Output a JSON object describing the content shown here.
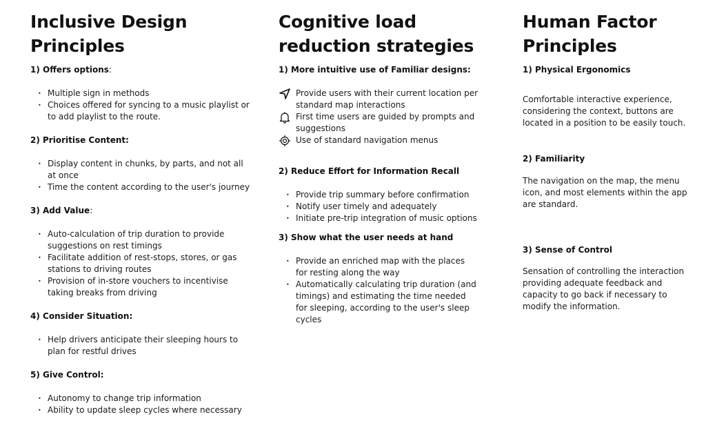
{
  "columns": [
    {
      "title_line1": "Inclusive Design",
      "title_line2": "Principles",
      "sections": [
        {
          "title": "1) Offers options",
          "suffix": ":",
          "items": [
            "Multiple sign in methods",
            "Choices offered for syncing to a music playlist or to add playlist to the route."
          ]
        },
        {
          "title": "2) Prioritise Content:",
          "suffix": "",
          "items": [
            "Display content in chunks, by parts, and not all at once",
            "Time the content according to the user's journey"
          ]
        },
        {
          "title": "3) Add Value",
          "suffix": ":",
          "items": [
            "Auto-calculation of trip duration to provide suggestions on rest timings",
            "Facilitate addition of rest-stops, stores, or gas stations to driving routes",
            "Provision of in-store vouchers to incentivise taking breaks from driving"
          ]
        },
        {
          "title": "4) Consider Situation:",
          "suffix": "",
          "items": [
            "Help drivers anticipate their sleeping hours to plan for restful drives"
          ]
        },
        {
          "title": "5) Give Control:",
          "suffix": "",
          "items": [
            "Autonomy to change trip information",
            "Ability to update sleep cycles where necessary"
          ]
        }
      ]
    },
    {
      "title_line1": "Cognitive load",
      "title_line2": "reduction strategies",
      "sections": [
        {
          "title": "1) More intuitive use of Familiar designs:",
          "icon_items": [
            {
              "icon": "navigation-arrow-icon",
              "text": "Provide users with their current location per standard map interactions"
            },
            {
              "icon": "bell-icon",
              "text": "First time users are guided by prompts and suggestions"
            },
            {
              "icon": "location-target-icon",
              "text": "Use of standard navigation menus"
            }
          ]
        },
        {
          "title": "2) Reduce Effort for Information Recall",
          "items": [
            "Provide trip summary before confirmation",
            "Notify user timely and adequately",
            "Initiate pre-trip integration of music options"
          ]
        },
        {
          "title": "3) Show what the user needs at hand",
          "items": [
            "Provide an enriched map with the places for resting along the way",
            "Automatically calculating trip duration (and timings) and estimating the time needed for sleeping, according to the user's sleep cycles"
          ]
        }
      ]
    },
    {
      "title_line1": "Human Factor",
      "title_line2": "Principles",
      "sections": [
        {
          "title": "1) Physical Ergonomics",
          "text": "Comfortable interactive experience, considering the context, buttons are located in a position to be easily touch."
        },
        {
          "title": "2) Familiarity",
          "text": "The navigation on the map, the menu icon, and most elements within the app are standard."
        },
        {
          "title": "3) Sense of Control",
          "text": "Sensation of controlling the interaction providing adequate feedback and capacity to go back if necessary to modify the information."
        }
      ]
    }
  ]
}
